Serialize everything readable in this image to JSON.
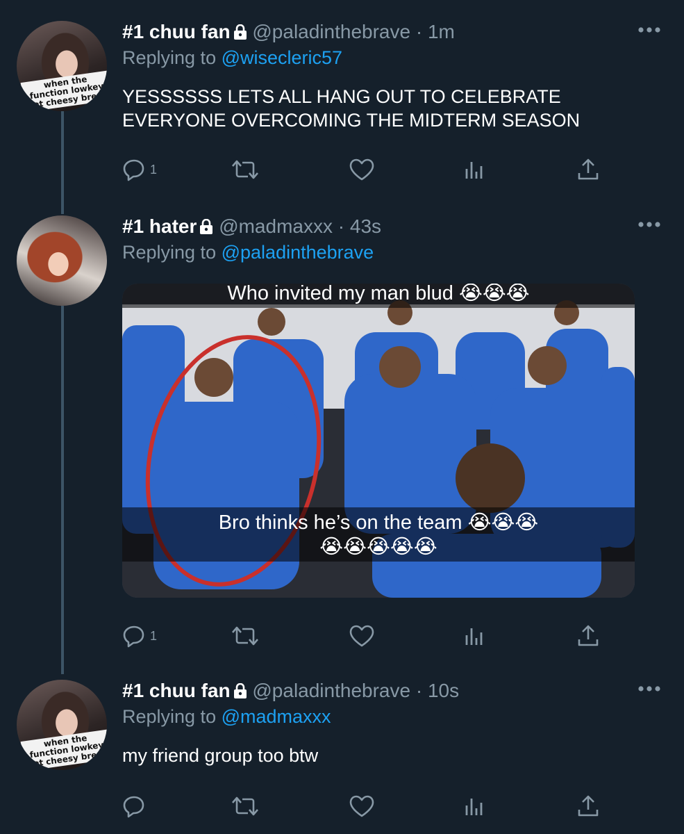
{
  "tweets": [
    {
      "display_name": "#1 chuu fan",
      "handle": "@paladinthebrave",
      "separator": "·",
      "time": "1m",
      "replying_prefix": "Replying to",
      "replying_to": "@wisecleric57",
      "text_line1": "YESSSSSS LETS ALL HANG OUT TO CELEBRATE",
      "text_line2": "EVERYONE OVERCOMING THE MIDTERM SEASON",
      "reply_count": "1",
      "avatar_sticker": "when the function lowkey got cheesy bread"
    },
    {
      "display_name": "#1 hater",
      "handle": "@madmaxxx",
      "separator": "·",
      "time": "43s",
      "replying_prefix": "Replying to",
      "replying_to": "@paladinthebrave",
      "media": {
        "caption_top": "Who invited my man blud 😭😭😭",
        "caption_bottom_line1": "Bro thinks he’s on the team 😭😭😭",
        "caption_bottom_line2": "😭😭😭😭😭"
      },
      "reply_count": "1"
    },
    {
      "display_name": "#1 chuu fan",
      "handle": "@paladinthebrave",
      "separator": "·",
      "time": "10s",
      "replying_prefix": "Replying to",
      "replying_to": "@madmaxxx",
      "text_line1": "my friend group too btw",
      "avatar_sticker": "when the function lowkey got cheesy bread"
    }
  ],
  "colors": {
    "background": "#15202b",
    "secondary_text": "#8899a6",
    "link": "#1da1f2",
    "thread_line": "#3d5466"
  }
}
